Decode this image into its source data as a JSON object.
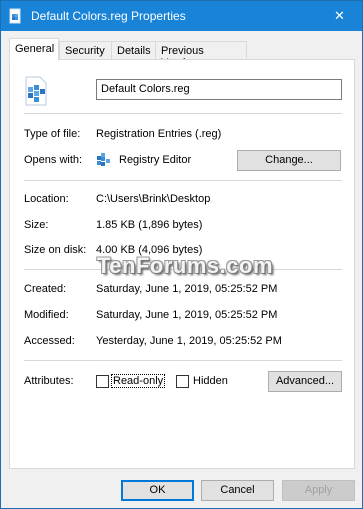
{
  "window": {
    "title": "Default Colors.reg Properties",
    "close_glyph": "✕",
    "accent_color": "#1883d7",
    "title_icon": "registry-file-icon"
  },
  "tabs": [
    {
      "label": "General",
      "active": true
    },
    {
      "label": "Security",
      "active": false
    },
    {
      "label": "Details",
      "active": false
    },
    {
      "label": "Previous Versions",
      "active": false
    }
  ],
  "general": {
    "file_icon": "registry-file-icon",
    "file_name": "Default Colors.reg",
    "type_label": "Type of file:",
    "type_value": "Registration Entries (.reg)",
    "opens_label": "Opens with:",
    "opens_icon": "registry-editor-icon",
    "opens_value": "Registry Editor",
    "change_button": "Change...",
    "location_label": "Location:",
    "location_value": "C:\\Users\\Brink\\Desktop",
    "size_label": "Size:",
    "size_value": "1.85 KB (1,896 bytes)",
    "size_on_disk_label": "Size on disk:",
    "size_on_disk_value": "4.00 KB (4,096 bytes)",
    "created_label": "Created:",
    "created_value": "Saturday, June 1, 2019, 05:25:52 PM",
    "modified_label": "Modified:",
    "modified_value": "Saturday, June 1, 2019, 05:25:52 PM",
    "accessed_label": "Accessed:",
    "accessed_value": "Yesterday, June 1, 2019, 05:25:52 PM",
    "attributes_label": "Attributes:",
    "readonly_label": "Read-only",
    "readonly_checked": false,
    "hidden_label": "Hidden",
    "hidden_checked": false,
    "advanced_button": "Advanced..."
  },
  "watermark": "TenForums.com",
  "footer": {
    "ok": "OK",
    "cancel": "Cancel",
    "apply": "Apply"
  }
}
